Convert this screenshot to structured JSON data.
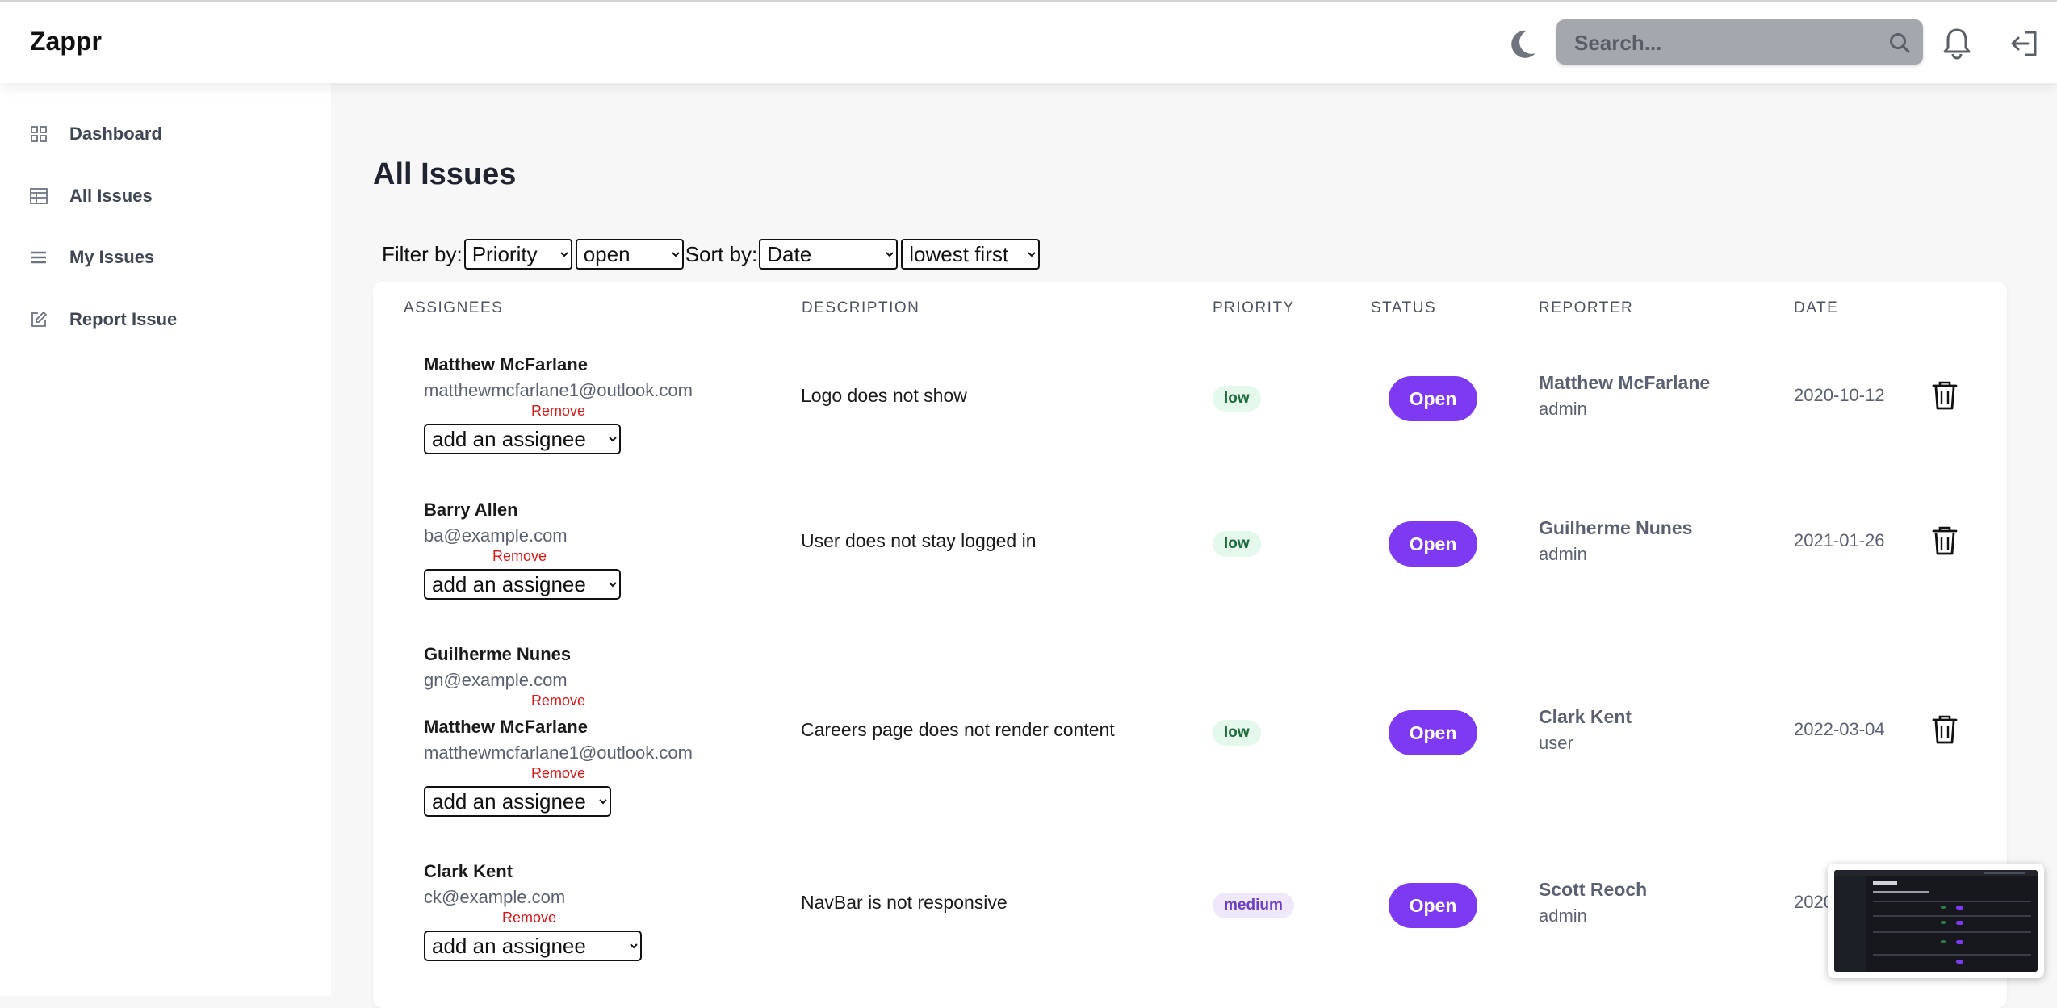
{
  "app": {
    "name": "Zappr"
  },
  "header": {
    "search_placeholder": "Search..."
  },
  "sidebar": {
    "items": [
      {
        "label": "Dashboard",
        "icon": "dashboard-grid-icon"
      },
      {
        "label": "All Issues",
        "icon": "table-icon"
      },
      {
        "label": "My Issues",
        "icon": "list-icon"
      },
      {
        "label": "Report Issue",
        "icon": "edit-icon"
      }
    ]
  },
  "page": {
    "title": "All Issues"
  },
  "filters": {
    "filter_label": "Filter by:",
    "filter_field": "Priority",
    "filter_value": "open",
    "sort_label": "Sort by:",
    "sort_field": "Date",
    "sort_order": "lowest first"
  },
  "table": {
    "headers": [
      "ASSIGNEES",
      "DESCRIPTION",
      "PRIORITY",
      "STATUS",
      "REPORTER",
      "DATE"
    ],
    "add_assignee_label": "add an assignee",
    "remove_label": "Remove",
    "rows": [
      {
        "assignees": [
          {
            "name": "Matthew McFarlane",
            "email": "matthewmcfarlane1@outlook.com"
          }
        ],
        "description": "Logo does not show",
        "priority": "low",
        "status": "Open",
        "reporter_name": "Matthew McFarlane",
        "reporter_role": "admin",
        "date": "2020-10-12"
      },
      {
        "assignees": [
          {
            "name": "Barry Allen",
            "email": "ba@example.com"
          }
        ],
        "description": "User does not stay logged in",
        "priority": "low",
        "status": "Open",
        "reporter_name": "Guilherme Nunes",
        "reporter_role": "admin",
        "date": "2021-01-26"
      },
      {
        "assignees": [
          {
            "name": "Guilherme Nunes",
            "email": "gn@example.com"
          },
          {
            "name": "Matthew McFarlane",
            "email": "matthewmcfarlane1@outlook.com"
          }
        ],
        "description": "Careers page does not render content",
        "priority": "low",
        "status": "Open",
        "reporter_name": "Clark Kent",
        "reporter_role": "user",
        "date": "2022-03-04"
      },
      {
        "assignees": [
          {
            "name": "Clark Kent",
            "email": "ck@example.com"
          }
        ],
        "description": "NavBar is not responsive",
        "priority": "medium",
        "status": "Open",
        "reporter_name": "Scott Reoch",
        "reporter_role": "admin",
        "date": "2020"
      }
    ]
  },
  "colors": {
    "accent": "#7e3af2",
    "remove": "#d01919",
    "low_bg": "#e5f8ec",
    "low_text": "#1e6b3c",
    "medium_bg": "#efe8fb",
    "medium_text": "#6b3fc2"
  }
}
